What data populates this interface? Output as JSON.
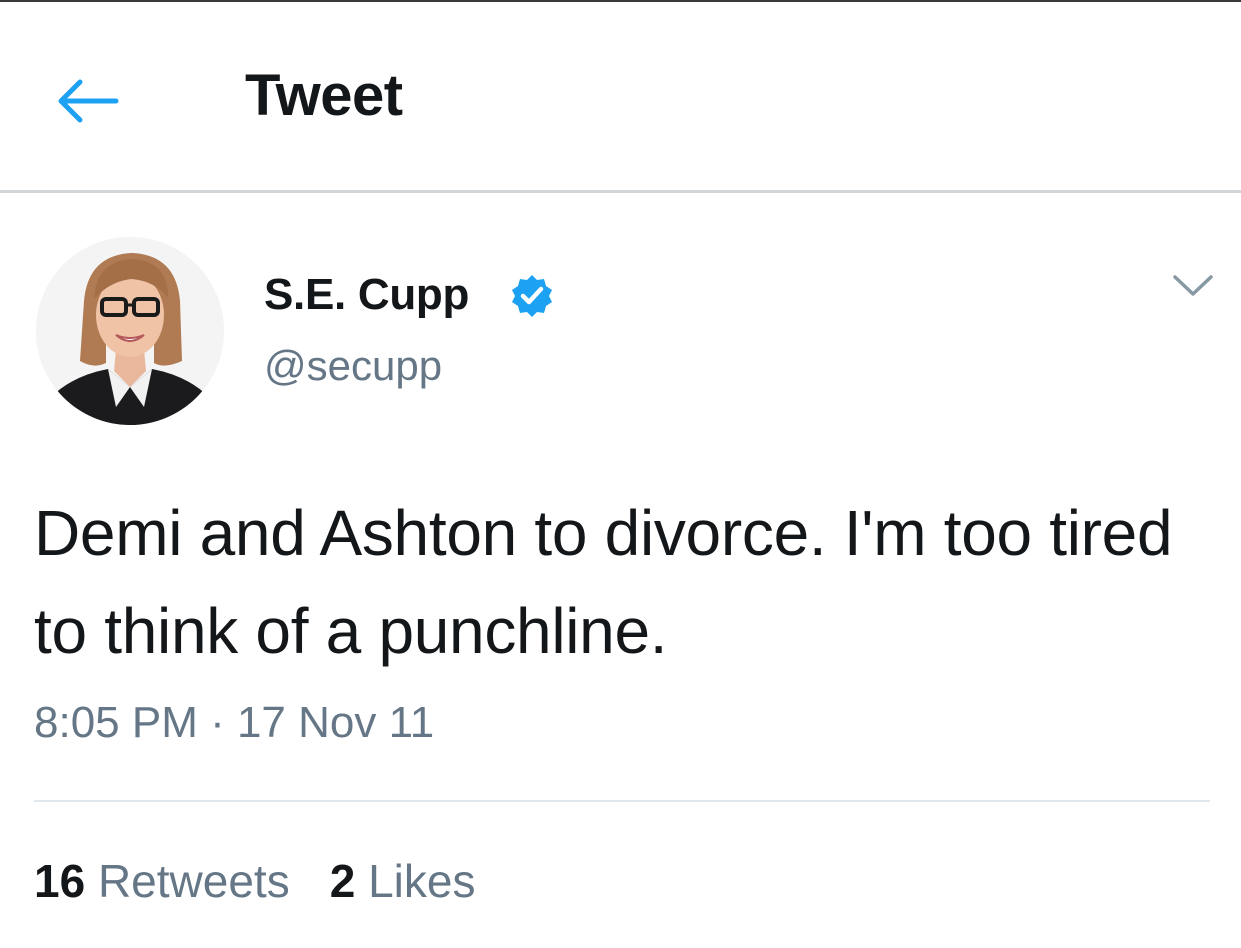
{
  "header": {
    "title": "Tweet",
    "back_icon": "arrow-left-icon",
    "accent_color": "#1da1f2"
  },
  "author": {
    "name": "S.E. Cupp",
    "handle": "@secupp",
    "verified": true,
    "verified_icon": "verified-badge-icon"
  },
  "tweet": {
    "text": "Demi and Ashton to divorce. I'm too tired to think of a punchline.",
    "timestamp": "8:05 PM · 17 Nov 11",
    "menu_icon": "chevron-down-icon"
  },
  "stats": {
    "retweets_count": "16",
    "retweets_label": "Retweets",
    "likes_count": "2",
    "likes_label": "Likes"
  },
  "colors": {
    "text": "#14171a",
    "secondary": "#657786",
    "divider": "#e1e8ed"
  }
}
